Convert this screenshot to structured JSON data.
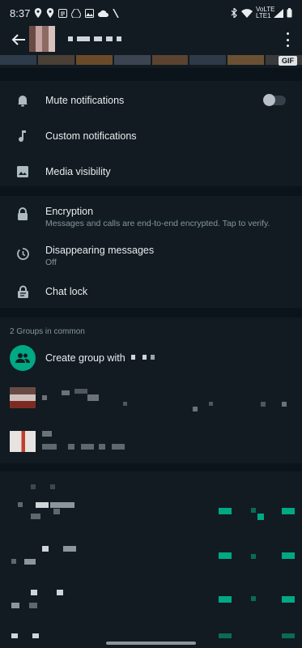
{
  "status_bar": {
    "time": "8:37",
    "network": "VoLTE LTE1"
  },
  "media_badge": "GIF",
  "settings": {
    "mute": {
      "label": "Mute notifications",
      "enabled": false
    },
    "custom": {
      "label": "Custom notifications"
    },
    "media": {
      "label": "Media visibility"
    },
    "encryption": {
      "label": "Encryption",
      "sub": "Messages and calls are end-to-end encrypted. Tap to verify."
    },
    "disappearing": {
      "label": "Disappearing messages",
      "sub": "Off"
    },
    "chatlock": {
      "label": "Chat lock"
    }
  },
  "groups": {
    "header": "2 Groups in common",
    "create_label": "Create group with"
  },
  "colors": {
    "background": "#111b21",
    "section_gap": "#0b141a",
    "accent": "#00a884"
  }
}
